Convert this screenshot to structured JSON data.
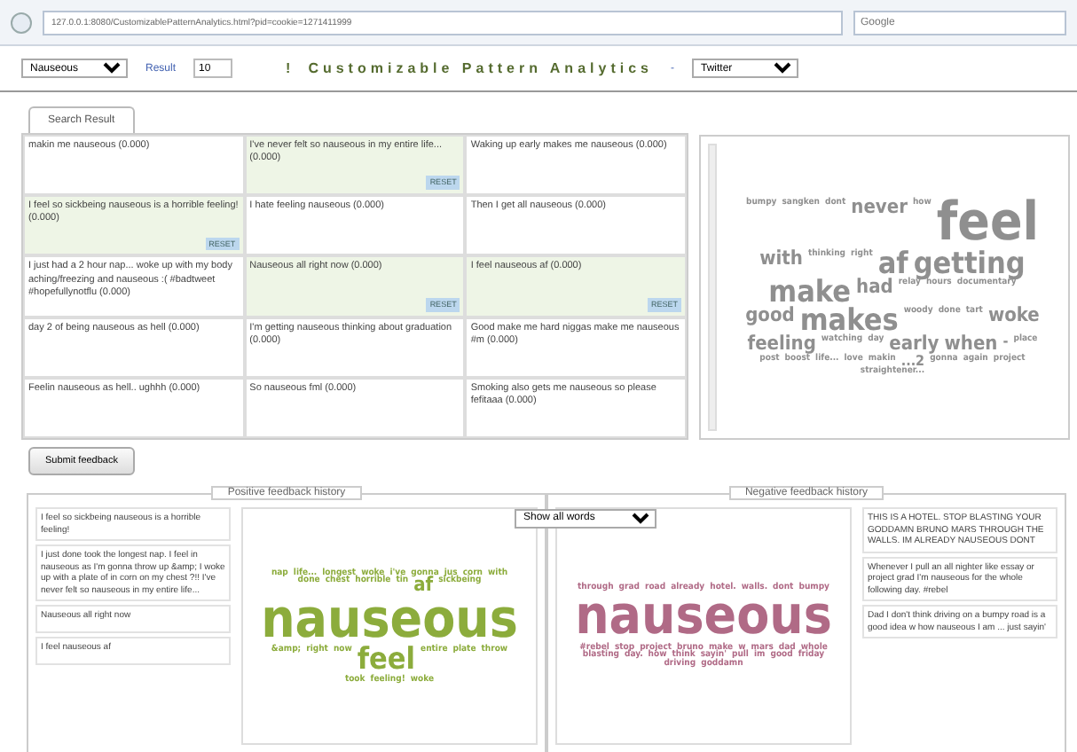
{
  "browser": {
    "url": "127.0.0.1:8080/CustomizablePatternAnalytics.html?pid=cookie=1271411999",
    "search_placeholder": "Google"
  },
  "toolbar": {
    "pattern": "Nauseous",
    "result_label": "Result",
    "result_value": "10",
    "mark": "!",
    "title": "Customizable Pattern Analytics",
    "separator": "-",
    "source": "Twitter"
  },
  "tabs": [
    {
      "label": "Search Result",
      "selected": true
    }
  ],
  "results": [
    {
      "text": "makin me nauseous (0.000)",
      "selected": false
    },
    {
      "text": "I've never felt so nauseous in my entire life... (0.000)",
      "selected": true,
      "badge": "RESET"
    },
    {
      "text": "Waking up early makes me nauseous (0.000)",
      "selected": false
    },
    {
      "text": "I feel so sickbeing nauseous is a horrible feeling! (0.000)",
      "selected": true,
      "badge": "RESET"
    },
    {
      "text": "I hate feeling nauseous (0.000)",
      "selected": false
    },
    {
      "text": "Then I get all nauseous (0.000)",
      "selected": false
    },
    {
      "text": "I just had a 2 hour nap... woke up with my body aching/freezing and nauseous :( #badtweet #hopefullynotflu (0.000)",
      "selected": false
    },
    {
      "text": "Nauseous all right now (0.000)",
      "selected": true,
      "badge": "RESET"
    },
    {
      "text": "I feel nauseous af (0.000)",
      "selected": true,
      "badge": "RESET"
    },
    {
      "text": "day 2 of being nauseous as hell (0.000)",
      "selected": false
    },
    {
      "text": "I'm getting nauseous thinking about graduation (0.000)",
      "selected": false
    },
    {
      "text": "Good make me hard niggas make me nauseous #m (0.000)",
      "selected": false
    },
    {
      "text": "Feelin nauseous as hell.. ughhh (0.000)",
      "selected": false
    },
    {
      "text": "So nauseous fml (0.000)",
      "selected": false
    },
    {
      "text": "Smoking also gets me nauseous so please fefitaaa (0.000)",
      "selected": false
    }
  ],
  "search_cloud": [
    {
      "word": "bumpy",
      "kind": "xs"
    },
    {
      "word": "sangken",
      "kind": "xs"
    },
    {
      "word": "dont",
      "kind": "xs"
    },
    {
      "word": "never",
      "kind": "m"
    },
    {
      "word": "how",
      "kind": "xs"
    },
    {
      "word": "feel",
      "kind": "xl"
    },
    {
      "word": "with",
      "kind": "m"
    },
    {
      "word": "thinking",
      "kind": "xs"
    },
    {
      "word": "right",
      "kind": "xs"
    },
    {
      "word": "af",
      "kind": "l"
    },
    {
      "word": "getting",
      "kind": "l"
    },
    {
      "word": "make",
      "kind": "l"
    },
    {
      "word": "had",
      "kind": "m"
    },
    {
      "word": "relay",
      "kind": "xs"
    },
    {
      "word": "hours",
      "kind": "xs"
    },
    {
      "word": "documentary",
      "kind": "xs"
    },
    {
      "word": "good",
      "kind": "m"
    },
    {
      "word": "makes",
      "kind": "l"
    },
    {
      "word": "woody",
      "kind": "xs"
    },
    {
      "word": "done",
      "kind": "xs"
    },
    {
      "word": "tart",
      "kind": "xs"
    },
    {
      "word": "woke",
      "kind": "m"
    },
    {
      "word": "feeling",
      "kind": "m"
    },
    {
      "word": "watching",
      "kind": "xs"
    },
    {
      "word": "day",
      "kind": "xs"
    },
    {
      "word": "early",
      "kind": "m"
    },
    {
      "word": "when",
      "kind": "m"
    },
    {
      "word": "-",
      "kind": "s"
    },
    {
      "word": "place",
      "kind": "xs"
    },
    {
      "word": "post",
      "kind": "xs"
    },
    {
      "word": "boost",
      "kind": "xs"
    },
    {
      "word": "life...",
      "kind": "xs"
    },
    {
      "word": "love",
      "kind": "xs"
    },
    {
      "word": "makin",
      "kind": "xs"
    },
    {
      "word": "...2",
      "kind": "s"
    },
    {
      "word": "gonna",
      "kind": "xs"
    },
    {
      "word": "again",
      "kind": "xs"
    },
    {
      "word": "project",
      "kind": "xs"
    },
    {
      "word": "straightener...",
      "kind": "xs"
    }
  ],
  "submit_label": "Submit feedback",
  "filter": "Show all words",
  "positive": {
    "title": "Positive feedback history",
    "items": [
      "I feel so sickbeing nauseous is a horrible feeling!",
      "I just done took the longest nap. I feel in nauseous as I'm gonna throw up &amp; I woke up with a plate of in corn on my chest ?!! I've never felt so nauseous in my entire life...",
      "Nauseous all right now",
      "I feel nauseous af"
    ],
    "cloud": [
      {
        "word": "nap",
        "kind": "xs"
      },
      {
        "word": "life...",
        "kind": "xs"
      },
      {
        "word": "longest",
        "kind": "xs"
      },
      {
        "word": "woke",
        "kind": "xs"
      },
      {
        "word": "i've",
        "kind": "xs"
      },
      {
        "word": "gonna",
        "kind": "xs"
      },
      {
        "word": "jus",
        "kind": "xs"
      },
      {
        "word": "corn",
        "kind": "xs"
      },
      {
        "word": "with",
        "kind": "xs"
      },
      {
        "word": "done",
        "kind": "xs"
      },
      {
        "word": "chest",
        "kind": "xs"
      },
      {
        "word": "horrible",
        "kind": "xs"
      },
      {
        "word": "tin",
        "kind": "xs"
      },
      {
        "word": "af",
        "kind": "m"
      },
      {
        "word": "sickbeing",
        "kind": "xs"
      },
      {
        "word": "nauseous",
        "kind": "xl"
      },
      {
        "word": "&amp;",
        "kind": "xs"
      },
      {
        "word": "right",
        "kind": "xs"
      },
      {
        "word": "now",
        "kind": "xs"
      },
      {
        "word": "feel",
        "kind": "l"
      },
      {
        "word": "entire",
        "kind": "xs"
      },
      {
        "word": "plate",
        "kind": "xs"
      },
      {
        "word": "throw",
        "kind": "xs"
      },
      {
        "word": "took",
        "kind": "xs"
      },
      {
        "word": "feeling!",
        "kind": "xs"
      },
      {
        "word": "woke",
        "kind": "xs"
      }
    ]
  },
  "negative": {
    "title": "Negative feedback history",
    "items": [
      "THIS IS A HOTEL. STOP BLASTING YOUR GODDAMN BRUNO MARS THROUGH THE WALLS. IM ALREADY NAUSEOUS DONT",
      "Whenever I pull an all nighter like essay or project grad I'm nauseous for the whole following day. #rebel",
      "Dad I don't think driving on a bumpy road is a good idea w how nauseous I am ... just sayin'"
    ],
    "cloud": [
      {
        "word": "through",
        "kind": "xs"
      },
      {
        "word": "grad",
        "kind": "xs"
      },
      {
        "word": "road",
        "kind": "xs"
      },
      {
        "word": "already",
        "kind": "xs"
      },
      {
        "word": "hotel.",
        "kind": "xs"
      },
      {
        "word": "walls.",
        "kind": "xs"
      },
      {
        "word": "dont",
        "kind": "xs"
      },
      {
        "word": "bumpy",
        "kind": "xs"
      },
      {
        "word": "nauseous",
        "kind": "xl"
      },
      {
        "word": "#rebel",
        "kind": "xs"
      },
      {
        "word": "stop",
        "kind": "xs"
      },
      {
        "word": "project",
        "kind": "xs"
      },
      {
        "word": "bruno",
        "kind": "xs"
      },
      {
        "word": "make",
        "kind": "xs"
      },
      {
        "word": "w",
        "kind": "xs"
      },
      {
        "word": "mars",
        "kind": "xs"
      },
      {
        "word": "dad",
        "kind": "xs"
      },
      {
        "word": "whole",
        "kind": "xs"
      },
      {
        "word": "blasting",
        "kind": "xs"
      },
      {
        "word": "day.",
        "kind": "xs"
      },
      {
        "word": "how",
        "kind": "xs"
      },
      {
        "word": "think",
        "kind": "xs"
      },
      {
        "word": "sayin'",
        "kind": "xs"
      },
      {
        "word": "pull",
        "kind": "xs"
      },
      {
        "word": "im",
        "kind": "xs"
      },
      {
        "word": "good",
        "kind": "xs"
      },
      {
        "word": "friday",
        "kind": "xs"
      },
      {
        "word": "driving",
        "kind": "xs"
      },
      {
        "word": "goddamn",
        "kind": "xs"
      }
    ]
  }
}
